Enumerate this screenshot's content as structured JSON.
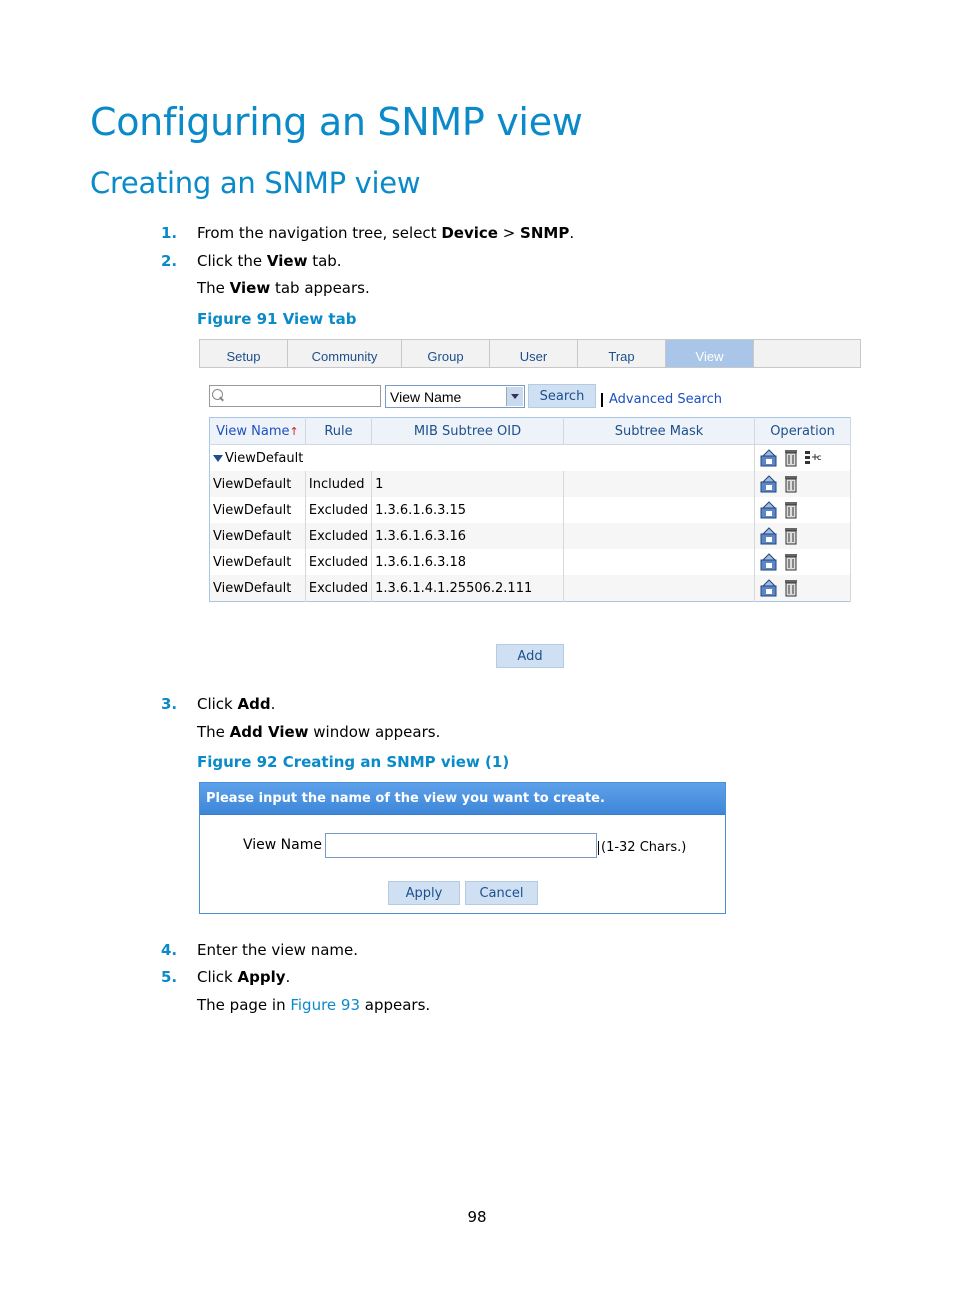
{
  "headings": {
    "h1": "Configuring an SNMP view",
    "h2": "Creating an SNMP view"
  },
  "steps": {
    "s1": {
      "num": "1.",
      "pre": "From the navigation tree, select ",
      "b1": "Device",
      "mid": " > ",
      "b2": "SNMP",
      "post": "."
    },
    "s2": {
      "num": "2.",
      "pre": "Click the ",
      "b1": "View",
      "post": " tab."
    },
    "s2_note": {
      "pre": "The ",
      "b1": "View",
      "post": " tab appears."
    },
    "s3": {
      "num": "3.",
      "pre": "Click ",
      "b1": "Add",
      "post": "."
    },
    "s3_note": {
      "pre": "The ",
      "b1": "Add View",
      "post": " window appears."
    },
    "s4": {
      "num": "4.",
      "text": "Enter the view name."
    },
    "s5": {
      "num": "5.",
      "pre": "Click ",
      "b1": "Apply",
      "post": "."
    },
    "s5_note": {
      "pre": "The page in ",
      "link": "Figure 93",
      "post": " appears."
    }
  },
  "figure91": {
    "caption": "Figure 91 View tab",
    "tabs": [
      "Setup",
      "Community",
      "Group",
      "User",
      "Trap",
      "View"
    ],
    "search": {
      "select_value": "View Name",
      "search_button": "Search",
      "advanced_link": "Advanced Search"
    },
    "table": {
      "headers": [
        "View Name",
        "Rule",
        "MIB Subtree OID",
        "Subtree Mask",
        "Operation"
      ],
      "group": "ViewDefault",
      "rows": [
        {
          "name": "ViewDefault",
          "rule": "Included",
          "oid": "1",
          "mask": ""
        },
        {
          "name": "ViewDefault",
          "rule": "Excluded",
          "oid": "1.3.6.1.6.3.15",
          "mask": ""
        },
        {
          "name": "ViewDefault",
          "rule": "Excluded",
          "oid": "1.3.6.1.6.3.16",
          "mask": ""
        },
        {
          "name": "ViewDefault",
          "rule": "Excluded",
          "oid": "1.3.6.1.6.3.18",
          "mask": ""
        },
        {
          "name": "ViewDefault",
          "rule": "Excluded",
          "oid": "1.3.6.1.4.1.25506.2.111",
          "mask": ""
        }
      ]
    },
    "add_button": "Add"
  },
  "figure92": {
    "caption": "Figure 92 Creating an SNMP view (1)",
    "header": "Please input the name of the view you want to create.",
    "label": "View Name",
    "hint": "(1-32 Chars.)",
    "apply": "Apply",
    "cancel": "Cancel"
  },
  "page_number": "98"
}
